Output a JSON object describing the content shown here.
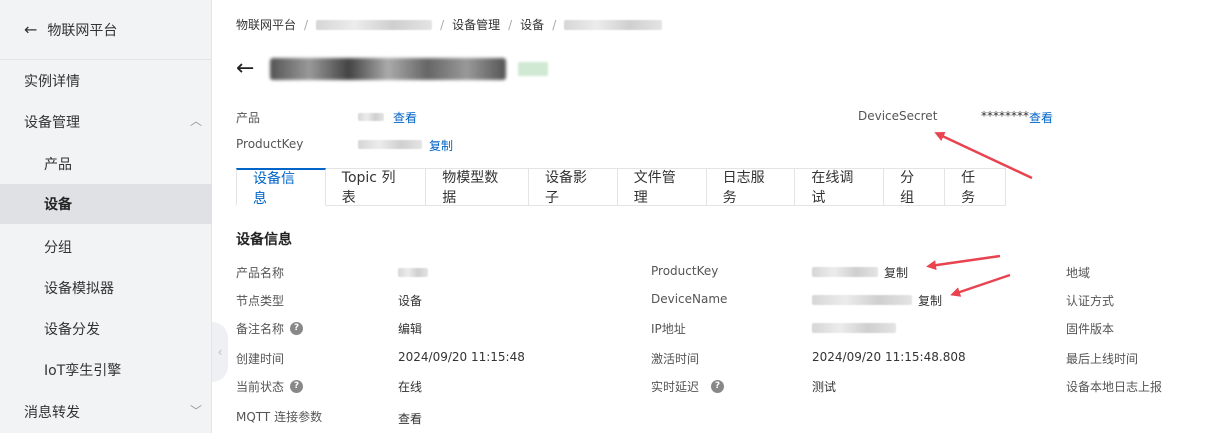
{
  "sidebar": {
    "header_title": "物联网平台",
    "items": [
      {
        "label": "实例详情"
      },
      {
        "label": "设备管理"
      },
      {
        "label": "产品"
      },
      {
        "label": "设备"
      },
      {
        "label": "分组"
      },
      {
        "label": "设备模拟器"
      },
      {
        "label": "设备分发"
      },
      {
        "label": "IoT孪生引擎"
      },
      {
        "label": "消息转发"
      }
    ]
  },
  "breadcrumb": {
    "items": [
      "物联网平台",
      "设备管理",
      "设备"
    ]
  },
  "meta": {
    "product_label": "产品",
    "view_link": "查看",
    "productkey_label": "ProductKey",
    "copy_link": "复制",
    "devicesecret_label": "DeviceSecret",
    "devicesecret_masked": "********",
    "devicesecret_view": "查看"
  },
  "tabs": [
    "设备信息",
    "Topic 列表",
    "物模型数据",
    "设备影子",
    "文件管理",
    "日志服务",
    "在线调试",
    "分组",
    "任务"
  ],
  "section_title": "设备信息",
  "info": {
    "col1": {
      "labels": [
        "产品名称",
        "节点类型",
        "备注名称",
        "创建时间",
        "当前状态",
        "MQTT 连接参数"
      ],
      "node_type": "设备",
      "remark_edit": "编辑",
      "created_time": "2024/09/20 11:15:48",
      "status": "在线",
      "mqtt_view": "查看"
    },
    "col2": {
      "labels": [
        "ProductKey",
        "DeviceName",
        "IP地址",
        "激活时间",
        "实时延迟"
      ],
      "copy": "复制",
      "activated_time": "2024/09/20 11:15:48.808",
      "latency_test": "测试"
    },
    "col3": {
      "labels": [
        "地域",
        "认证方式",
        "固件版本",
        "最后上线时间",
        "设备本地日志上报"
      ]
    }
  },
  "colors": {
    "link": "#0064c8",
    "annotation_arrow": "#e8434f"
  }
}
